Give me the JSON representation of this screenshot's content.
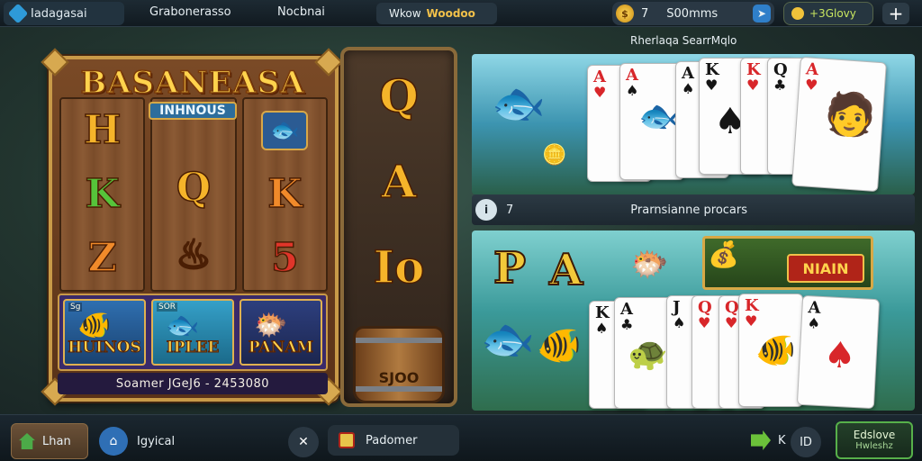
{
  "topbar": {
    "brand": "Iadagasai",
    "nav": [
      "Grabonerasso",
      "Nocbnai"
    ],
    "wallet_label": "Wkow",
    "wallet_value": "Woodoo",
    "coins_count": "7",
    "coins_value": "S00mms",
    "level_text": "+3Glovy",
    "add_label": "+"
  },
  "slot": {
    "title": "BASANEASA",
    "subtitle": "INHNOUS",
    "reels": [
      [
        "H",
        "K",
        "Z"
      ],
      [
        "Q",
        "",
        ""
      ],
      [
        "K",
        "5",
        ""
      ]
    ],
    "bonus": [
      {
        "tag": "Sg",
        "label": "HUINOS"
      },
      {
        "tag": "SOR",
        "label": "IPLEE"
      },
      {
        "tag": "",
        "label": "PANAM"
      }
    ],
    "jackpot": "Soamer JGeJ6 - 2453080"
  },
  "side_reel": {
    "symbols": [
      "Q",
      "A",
      "Io"
    ],
    "barrel_label": "SJOO"
  },
  "right": {
    "panel_title": "Rherlaqa SearrMqlo",
    "cards_top": [
      {
        "rank": "A",
        "suit": "♥",
        "color": "red"
      },
      {
        "rank": "A",
        "suit": "♠",
        "color": "black"
      },
      {
        "rank": "A",
        "suit": "♠",
        "color": "black"
      },
      {
        "rank": "K",
        "suit": "♥",
        "color": "red"
      },
      {
        "rank": "Q",
        "suit": "♣",
        "color": "black"
      },
      {
        "rank": "A",
        "suit": "♥",
        "color": "red"
      }
    ],
    "info_count": "7",
    "info_text": "Prarnsianne procars",
    "big_letters": [
      "P",
      "A"
    ],
    "win_label": "NIAIN",
    "cards_bottom": [
      {
        "rank": "K",
        "suit": "♠",
        "color": "black"
      },
      {
        "rank": "A",
        "suit": "♣",
        "color": "black"
      },
      {
        "rank": "J",
        "suit": "♠",
        "color": "black"
      },
      {
        "rank": "Q",
        "suit": "♥",
        "color": "red"
      },
      {
        "rank": "K",
        "suit": "♥",
        "color": "red"
      },
      {
        "rank": "A",
        "suit": "♠",
        "color": "black"
      }
    ]
  },
  "bottombar": {
    "home": "Lhan",
    "special": "Igyical",
    "search": "Padomer",
    "count": "K",
    "circle": "ID",
    "cta_main": "Edslove",
    "cta_sub": "Hwleshz"
  }
}
